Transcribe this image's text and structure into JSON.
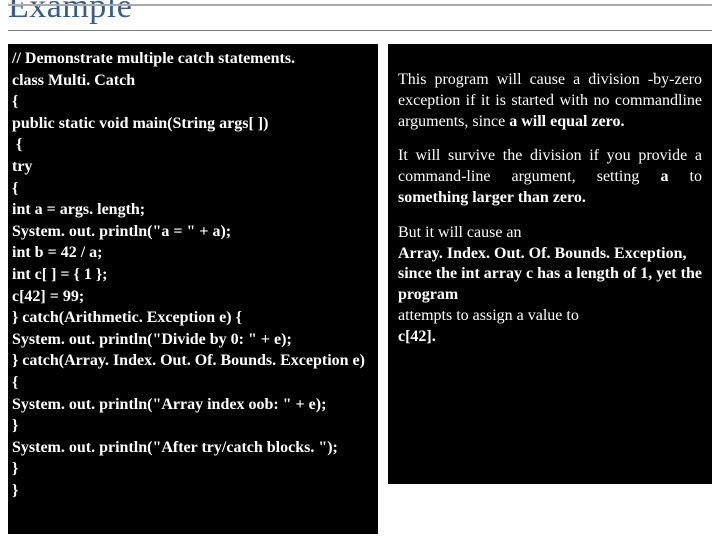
{
  "title": "Example",
  "code": {
    "lines": [
      "// Demonstrate multiple catch statements.",
      "class Multi. Catch",
      "{",
      "public static void main(String args[ ])",
      " {",
      "try",
      "{",
      "int a = args. length;",
      "System. out. println(\"a = \" + a);",
      "int b = 42 / a;",
      "int c[ ] = { 1 };",
      "c[42] = 99;",
      "} catch(Arithmetic. Exception e) {",
      "System. out. println(\"Divide by 0: \" + e);",
      "} catch(Array. Index. Out. Of. Bounds. Exception e)",
      "{",
      "System. out. println(\"Array index oob: \" + e);",
      "}",
      "System. out. println(\"After try/catch blocks. \");",
      "}",
      "}"
    ]
  },
  "explain": {
    "p1a": "This program will cause a division -by-zero exception if it is started with no commandline arguments, since ",
    "p1b": "a will equal zero.",
    "p2a": "It will survive the division if you provide a command-line argument, setting ",
    "p2b": "a",
    "p2c": " to ",
    "p2d": "something larger than zero.",
    "p3a": "But it will cause an",
    "p3b": "Array. Index. Out. Of. Bounds. Exception, since the int array c has a length of 1, yet the program",
    "p3c": "attempts to assign a value to",
    "p3d": "c[42]."
  }
}
